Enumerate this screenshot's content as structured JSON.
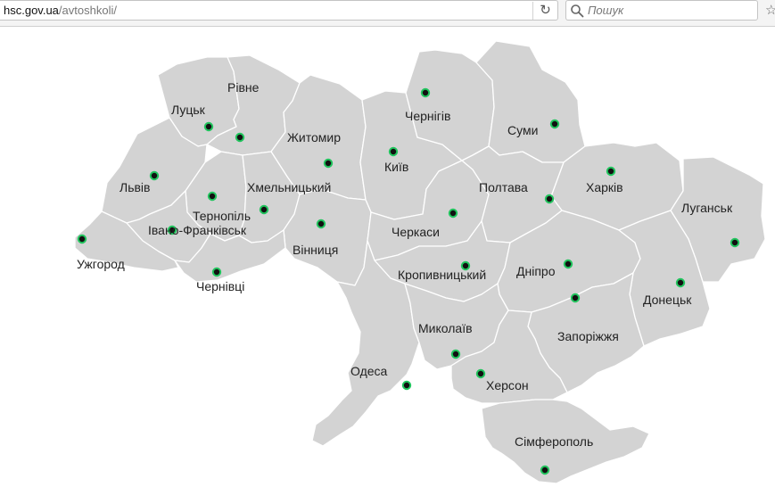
{
  "browser": {
    "url_host": "hsc.gov.ua",
    "url_path": "/avtoshkoli/",
    "reload_icon": "reload-icon",
    "search_placeholder": "Пошук",
    "search_icon": "magnifier-icon",
    "bookmark_icon": "star-icon"
  },
  "map": {
    "fill_color": "#d3d3d3",
    "border_color": "#ffffff",
    "marker_fill": "#111111",
    "marker_ring": "#22c55e",
    "regions": [
      {
        "name": "Рівне"
      },
      {
        "name": "Луцьк"
      },
      {
        "name": "Житомир"
      },
      {
        "name": "Чернігів"
      },
      {
        "name": "Суми"
      },
      {
        "name": "Київ"
      },
      {
        "name": "Львів"
      },
      {
        "name": "Хмельницький"
      },
      {
        "name": "Тернопіль"
      },
      {
        "name": "Полтава"
      },
      {
        "name": "Харків"
      },
      {
        "name": "Луганськ"
      },
      {
        "name": "Івано-Франківськ"
      },
      {
        "name": "Черкаси"
      },
      {
        "name": "Вінниця"
      },
      {
        "name": "Ужгород"
      },
      {
        "name": "Чернівці"
      },
      {
        "name": "Кропивницький"
      },
      {
        "name": "Дніпро"
      },
      {
        "name": "Донецьк"
      },
      {
        "name": "Миколаїв"
      },
      {
        "name": "Запоріжжя"
      },
      {
        "name": "Одеса"
      },
      {
        "name": "Херсон"
      },
      {
        "name": "Сімферополь"
      }
    ]
  }
}
